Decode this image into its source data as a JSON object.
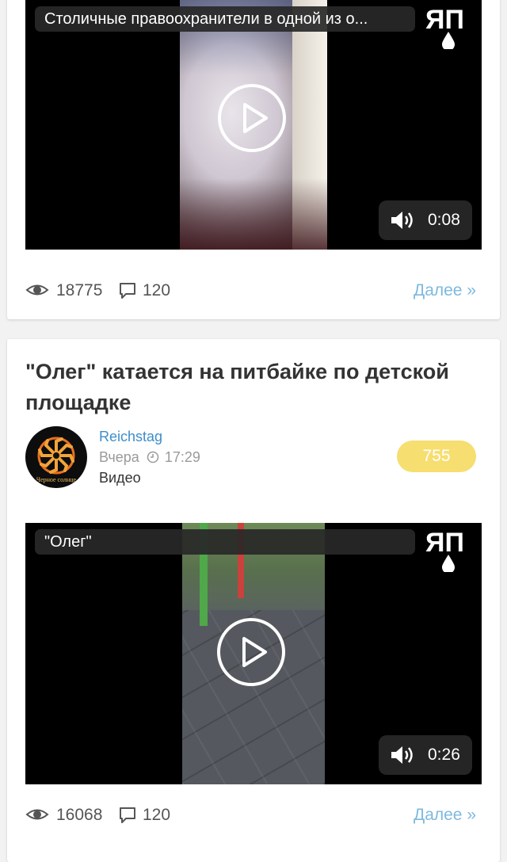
{
  "posts": [
    {
      "video": {
        "title": "Столичные правоохранители в одной из о...",
        "duration": "0:08",
        "logo_icon": "yap-logo-icon"
      },
      "stats": {
        "views": "18775",
        "comments": "120"
      },
      "more_label": "Далее »"
    },
    {
      "title": "\"Олег\" катается на питбайке по детской площадке",
      "author": "Reichstag",
      "date": "Вчера",
      "time": "17:29",
      "category": "Видео",
      "rating": "755",
      "avatar_text": "Черное солнце",
      "video": {
        "title": "\"Олег\"",
        "duration": "0:26",
        "logo_icon": "yap-logo-icon"
      },
      "stats": {
        "views": "16068",
        "comments": "120"
      },
      "more_label": "Далее »"
    }
  ],
  "colors": {
    "link": "#3d8ec9",
    "more": "#7fb9de",
    "rating_bg": "#f6de70",
    "background": "#f2f2f2"
  }
}
